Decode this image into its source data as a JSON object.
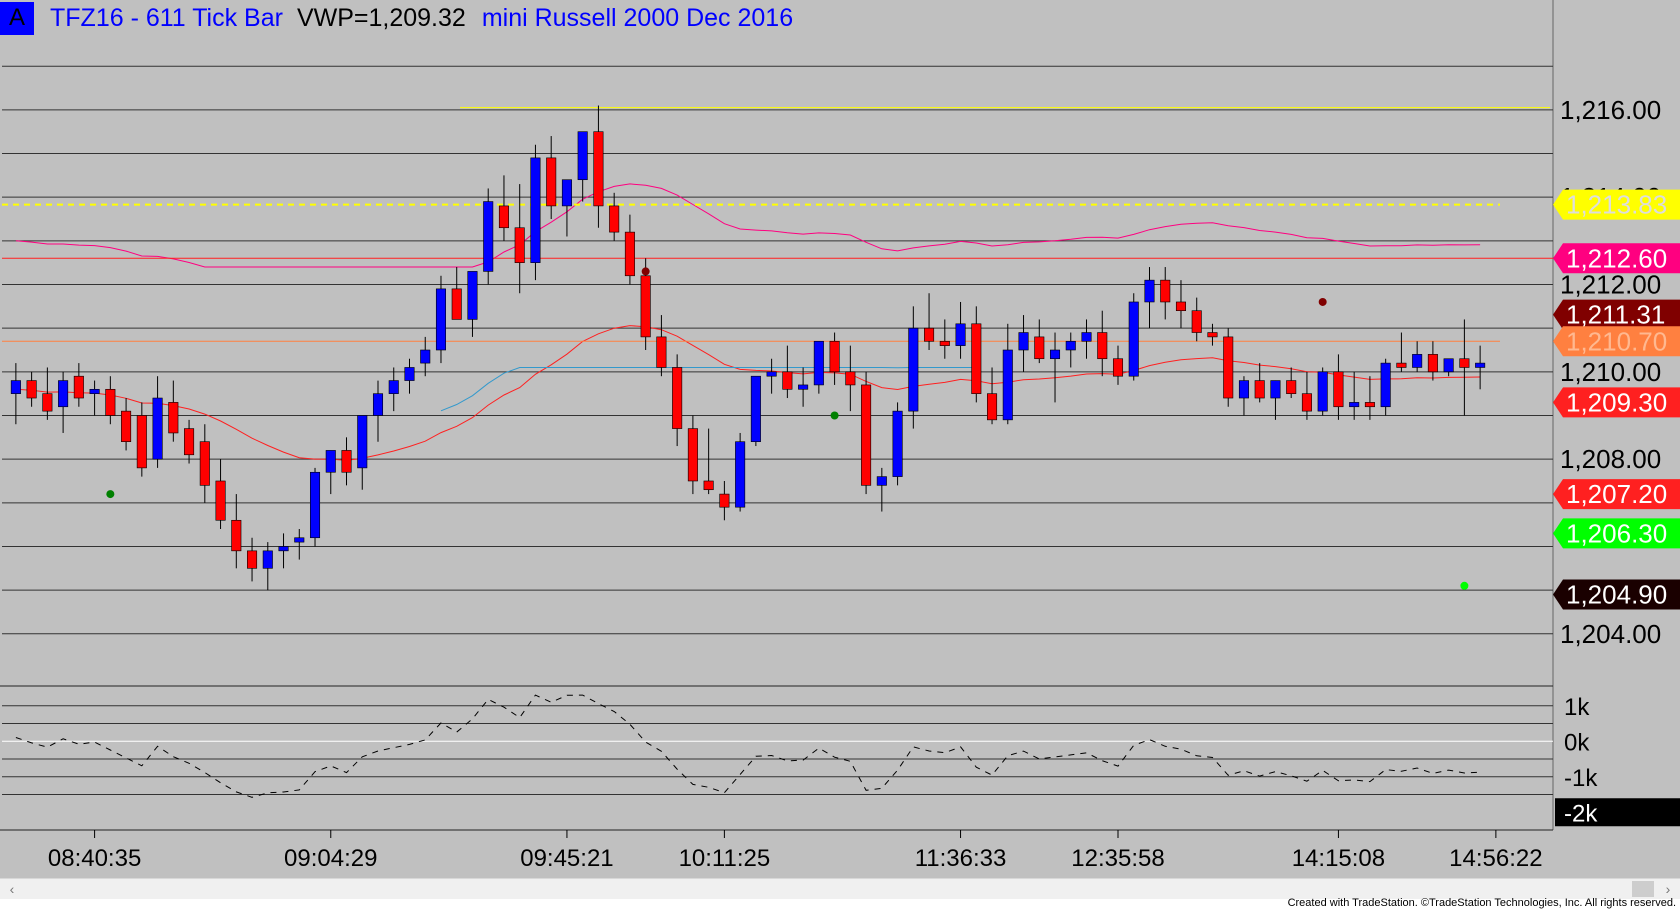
{
  "header": {
    "badge": "A",
    "symbol_text": "TFZ16 - 611 Tick Bar",
    "vwp_text": "VWP=1,209.32",
    "name_text": "mini Russell 2000 Dec 2016"
  },
  "footer": {
    "copyright": "Created with TradeStation. ©TradeStation Technologies, Inc. All rights reserved."
  },
  "colors": {
    "background": "#c0c0c0",
    "up_candle": "#0000ff",
    "down_candle": "#ff0000",
    "vwap": "#ffff00",
    "upper_band": "#ff0080",
    "lower_band": "#ff2020",
    "ma": "#3399cc",
    "orange_level": "#ff8040"
  },
  "chart_data": [
    {
      "type": "candlestick",
      "title": "TFZ16 - 611 Tick Bar",
      "ylim": [
        1203.4,
        1217.6
      ],
      "y_ticks": [
        1204,
        1206,
        1208,
        1210,
        1212,
        1214,
        1216
      ],
      "y_tick_labels": [
        "1,204.00",
        "1,206.00",
        "1,208.00",
        "1,210.00",
        "1,212.00",
        "1,214.00",
        "1,216.00"
      ],
      "x_tick_labels": [
        "08:40:35",
        "09:04:29",
        "09:45:21",
        "10:11:25",
        "11:36:33",
        "12:35:58",
        "14:15:08",
        "14:56:22"
      ],
      "x_tick_bar_index": [
        5,
        20,
        35,
        45,
        60,
        70,
        84,
        94
      ],
      "bars": [
        [
          1209.5,
          1210.2,
          1208.8,
          1209.8
        ],
        [
          1209.8,
          1210.0,
          1209.2,
          1209.4
        ],
        [
          1209.5,
          1210.1,
          1208.9,
          1209.1
        ],
        [
          1209.2,
          1210.0,
          1208.6,
          1209.8
        ],
        [
          1209.9,
          1210.2,
          1209.2,
          1209.4
        ],
        [
          1209.5,
          1209.8,
          1209.0,
          1209.6
        ],
        [
          1209.6,
          1209.9,
          1208.8,
          1209.0
        ],
        [
          1209.1,
          1209.4,
          1208.2,
          1208.4
        ],
        [
          1209.0,
          1209.3,
          1207.6,
          1207.8
        ],
        [
          1208.0,
          1209.9,
          1207.8,
          1209.4
        ],
        [
          1209.3,
          1209.8,
          1208.4,
          1208.6
        ],
        [
          1208.7,
          1208.9,
          1207.9,
          1208.1
        ],
        [
          1208.4,
          1208.8,
          1207.0,
          1207.4
        ],
        [
          1207.5,
          1208.0,
          1206.4,
          1206.6
        ],
        [
          1206.6,
          1207.2,
          1205.5,
          1205.9
        ],
        [
          1205.9,
          1206.2,
          1205.2,
          1205.5
        ],
        [
          1205.5,
          1206.1,
          1205.0,
          1205.9
        ],
        [
          1205.9,
          1206.3,
          1205.5,
          1206.0
        ],
        [
          1206.1,
          1206.4,
          1205.7,
          1206.2
        ],
        [
          1206.2,
          1207.8,
          1206.0,
          1207.7
        ],
        [
          1207.7,
          1208.2,
          1207.2,
          1208.2
        ],
        [
          1208.2,
          1208.5,
          1207.4,
          1207.7
        ],
        [
          1207.8,
          1209.0,
          1207.3,
          1209.0
        ],
        [
          1209.0,
          1209.8,
          1208.4,
          1209.5
        ],
        [
          1209.5,
          1210.1,
          1209.1,
          1209.8
        ],
        [
          1209.8,
          1210.3,
          1209.5,
          1210.1
        ],
        [
          1210.2,
          1210.8,
          1209.9,
          1210.5
        ],
        [
          1210.5,
          1212.2,
          1210.2,
          1211.9
        ],
        [
          1211.9,
          1212.4,
          1211.3,
          1211.2
        ],
        [
          1211.2,
          1212.3,
          1210.8,
          1212.3
        ],
        [
          1212.3,
          1214.2,
          1212.0,
          1213.9
        ],
        [
          1213.8,
          1214.5,
          1213.0,
          1213.3
        ],
        [
          1213.3,
          1214.3,
          1211.8,
          1212.5
        ],
        [
          1212.5,
          1215.2,
          1212.1,
          1214.9
        ],
        [
          1214.9,
          1215.4,
          1213.5,
          1213.8
        ],
        [
          1213.8,
          1214.4,
          1213.1,
          1214.4
        ],
        [
          1214.4,
          1215.5,
          1213.9,
          1215.5
        ],
        [
          1215.5,
          1216.1,
          1213.3,
          1213.8
        ],
        [
          1213.8,
          1214.1,
          1213.0,
          1213.2
        ],
        [
          1213.2,
          1213.6,
          1212.0,
          1212.2
        ],
        [
          1212.2,
          1212.6,
          1210.5,
          1210.8
        ],
        [
          1210.8,
          1211.3,
          1209.9,
          1210.1
        ],
        [
          1210.1,
          1210.4,
          1208.3,
          1208.7
        ],
        [
          1208.7,
          1209.0,
          1207.2,
          1207.5
        ],
        [
          1207.5,
          1208.7,
          1207.2,
          1207.3
        ],
        [
          1207.2,
          1207.5,
          1206.6,
          1206.9
        ],
        [
          1206.9,
          1208.6,
          1206.8,
          1208.4
        ],
        [
          1208.4,
          1209.9,
          1208.3,
          1209.9
        ],
        [
          1209.9,
          1210.3,
          1209.5,
          1210.0
        ],
        [
          1210.0,
          1210.6,
          1209.4,
          1209.6
        ],
        [
          1209.6,
          1210.1,
          1209.2,
          1209.7
        ],
        [
          1209.7,
          1210.7,
          1209.5,
          1210.7
        ],
        [
          1210.7,
          1210.9,
          1209.7,
          1210.0
        ],
        [
          1210.0,
          1210.6,
          1209.1,
          1209.7
        ],
        [
          1209.7,
          1210.0,
          1207.2,
          1207.4
        ],
        [
          1207.4,
          1207.8,
          1206.8,
          1207.6
        ],
        [
          1207.6,
          1209.3,
          1207.4,
          1209.1
        ],
        [
          1209.1,
          1211.5,
          1208.7,
          1211.0
        ],
        [
          1211.0,
          1211.8,
          1210.5,
          1210.7
        ],
        [
          1210.7,
          1211.2,
          1210.3,
          1210.6
        ],
        [
          1210.6,
          1211.6,
          1210.3,
          1211.1
        ],
        [
          1211.1,
          1211.5,
          1209.3,
          1209.5
        ],
        [
          1209.5,
          1210.1,
          1208.8,
          1208.9
        ],
        [
          1208.9,
          1211.1,
          1208.8,
          1210.5
        ],
        [
          1210.5,
          1211.3,
          1210.0,
          1210.9
        ],
        [
          1210.8,
          1211.2,
          1210.2,
          1210.3
        ],
        [
          1210.3,
          1210.9,
          1209.3,
          1210.5
        ],
        [
          1210.5,
          1210.9,
          1210.1,
          1210.7
        ],
        [
          1210.7,
          1211.2,
          1210.3,
          1210.9
        ],
        [
          1210.9,
          1211.4,
          1209.9,
          1210.3
        ],
        [
          1210.3,
          1210.6,
          1209.7,
          1209.9
        ],
        [
          1209.9,
          1211.8,
          1209.8,
          1211.6
        ],
        [
          1211.6,
          1212.4,
          1211.0,
          1212.1
        ],
        [
          1212.1,
          1212.4,
          1211.2,
          1211.6
        ],
        [
          1211.6,
          1212.1,
          1211.0,
          1211.4
        ],
        [
          1211.4,
          1211.7,
          1210.7,
          1210.9
        ],
        [
          1210.9,
          1211.1,
          1210.6,
          1210.8
        ],
        [
          1210.8,
          1211.0,
          1209.2,
          1209.4
        ],
        [
          1209.4,
          1209.9,
          1209.0,
          1209.8
        ],
        [
          1209.8,
          1210.2,
          1209.3,
          1209.4
        ],
        [
          1209.4,
          1209.8,
          1208.9,
          1209.8
        ],
        [
          1209.8,
          1210.1,
          1209.4,
          1209.5
        ],
        [
          1209.5,
          1210.0,
          1208.9,
          1209.1
        ],
        [
          1209.1,
          1210.1,
          1209.0,
          1210.0
        ],
        [
          1210.0,
          1210.4,
          1208.9,
          1209.2
        ],
        [
          1209.2,
          1210.0,
          1208.9,
          1209.3
        ],
        [
          1209.3,
          1209.9,
          1208.9,
          1209.2
        ],
        [
          1209.2,
          1210.3,
          1209.0,
          1210.2
        ],
        [
          1210.2,
          1210.9,
          1210.0,
          1210.1
        ],
        [
          1210.1,
          1210.7,
          1210.0,
          1210.4
        ],
        [
          1210.4,
          1210.7,
          1209.8,
          1210.0
        ],
        [
          1210.0,
          1210.3,
          1209.9,
          1210.3
        ],
        [
          1210.3,
          1211.2,
          1209.0,
          1210.1
        ],
        [
          1210.1,
          1210.6,
          1209.6,
          1210.2
        ]
      ]
    }
  ],
  "price_scale": [
    {
      "text": "1,216.00",
      "value": 1216,
      "kind": "tick"
    },
    {
      "text": "1,214.00",
      "value": 1214,
      "kind": "tick"
    },
    {
      "text": "1,213.83",
      "value": 1213.83,
      "kind": "marker",
      "bg": "#ffff00",
      "fg": "#dddddd"
    },
    {
      "text": "1,212.60",
      "value": 1212.6,
      "kind": "marker",
      "bg": "#ff0080",
      "fg": "#ffffff"
    },
    {
      "text": "1,212.00",
      "value": 1212,
      "kind": "tick"
    },
    {
      "text": "1,211.31",
      "value": 1211.31,
      "kind": "marker",
      "bg": "#800000",
      "fg": "#ffffff"
    },
    {
      "text": "1,210.70",
      "value": 1210.7,
      "kind": "marker",
      "bg": "#ff8040",
      "fg": "#ffb890"
    },
    {
      "text": "1,210.00",
      "value": 1210,
      "kind": "tick"
    },
    {
      "text": "1,209.30",
      "value": 1209.3,
      "kind": "marker",
      "bg": "#ff2020",
      "fg": "#ffffff"
    },
    {
      "text": "1,208.00",
      "value": 1208,
      "kind": "tick"
    },
    {
      "text": "1,207.20",
      "value": 1207.2,
      "kind": "marker",
      "bg": "#ff2020",
      "fg": "#ffffff"
    },
    {
      "text": "1,206.30",
      "value": 1206.3,
      "kind": "marker",
      "bg": "#00ff00",
      "fg": "#ffffff"
    },
    {
      "text": "1,204.90",
      "value": 1204.9,
      "kind": "marker",
      "bg": "#1a0000",
      "fg": "#ffffff"
    },
    {
      "text": "1,204.00",
      "value": 1204,
      "kind": "tick"
    }
  ],
  "lower_panel": {
    "ylim": [
      -2.5,
      1.5
    ],
    "y_tick_labels": [
      {
        "text": "1k",
        "value": 1
      },
      {
        "text": "0k",
        "value": 0
      },
      {
        "text": "-1k",
        "value": -1
      },
      {
        "text": "-2k",
        "value": -2,
        "boxed": true
      }
    ]
  }
}
